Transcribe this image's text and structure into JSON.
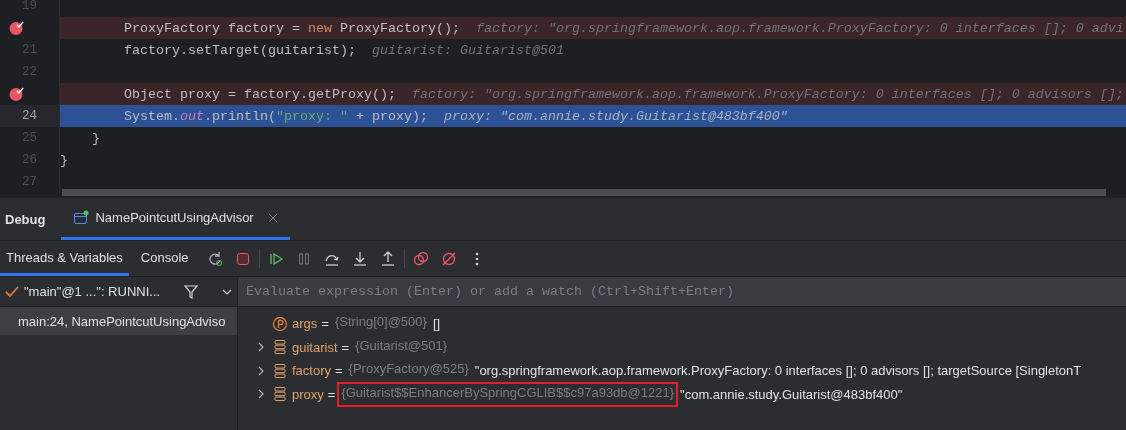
{
  "editor": {
    "lines": [
      {
        "number": "19",
        "breakpoint": false,
        "current": false
      },
      {
        "breakpoint": true,
        "current": false,
        "tokens": [
          {
            "kind": "plain",
            "text": "        ProxyFactory factory = "
          },
          {
            "kind": "keyword",
            "text": "new"
          },
          {
            "kind": "plain",
            "text": " ProxyFactory();"
          }
        ],
        "hint": "factory: \"org.springframework.aop.framework.ProxyFactory: 0 interfaces []; 0 advi"
      },
      {
        "number": "21",
        "breakpoint": false,
        "current": false,
        "tokens": [
          {
            "kind": "plain",
            "text": "        factory.setTarget(guitarist);"
          }
        ],
        "hint": "guitarist: Guitarist@501"
      },
      {
        "number": "22",
        "breakpoint": false,
        "current": false
      },
      {
        "breakpoint": true,
        "current": false,
        "tokens": [
          {
            "kind": "plain",
            "text": "        Object proxy = factory.getProxy();"
          }
        ],
        "hint": "factory: \"org.springframework.aop.framework.ProxyFactory: 0 interfaces []; 0 advisors [];"
      },
      {
        "number": "24",
        "breakpoint": false,
        "current": true,
        "tokens": [
          {
            "kind": "plain",
            "text": "        System."
          },
          {
            "kind": "static",
            "text": "out"
          },
          {
            "kind": "plain",
            "text": ".println("
          },
          {
            "kind": "string",
            "text": "\"proxy: \""
          },
          {
            "kind": "plain",
            "text": " + proxy);"
          }
        ],
        "hint": "proxy: \"com.annie.study.Guitarist@483bf400\""
      },
      {
        "number": "25",
        "breakpoint": false,
        "current": false,
        "tokens": [
          {
            "kind": "plain",
            "text": "    }"
          }
        ]
      },
      {
        "number": "26",
        "breakpoint": false,
        "current": false,
        "tokens": [
          {
            "kind": "plain",
            "text": "}"
          }
        ]
      },
      {
        "number": "27",
        "breakpoint": false,
        "current": false
      }
    ]
  },
  "debug": {
    "title": "Debug",
    "session_tabs": [
      {
        "label": "NamePointcutUsingAdvisor",
        "selected": true
      }
    ],
    "view_tabs": [
      {
        "label": "Threads & Variables",
        "selected": true
      },
      {
        "label": "Console",
        "selected": false
      }
    ],
    "thread": "\"main\"@1 ...\": RUNNI...",
    "evaluate": {
      "placeholder": "Evaluate expression (Enter) or add a watch (Ctrl+Shift+Enter)"
    },
    "frames": [
      {
        "label": "main:24, NamePointcutUsingAdviso",
        "selected": true
      }
    ],
    "variables": [
      {
        "kind": "param",
        "expandable": false,
        "name": "args",
        "operator": "=",
        "type": "{String[0]@500}",
        "value": "[]",
        "boxed": false
      },
      {
        "kind": "field",
        "expandable": true,
        "name": "guitarist",
        "operator": "=",
        "type": "{Guitarist@501}",
        "boxed": false
      },
      {
        "kind": "field",
        "expandable": true,
        "name": "factory",
        "operator": "=",
        "type": "{ProxyFactory@525}",
        "value": "\"org.springframework.aop.framework.ProxyFactory: 0 interfaces []; 0 advisors []; targetSource [SingletonT",
        "boxed": false
      },
      {
        "kind": "field",
        "expandable": true,
        "name": "proxy",
        "operator": "=",
        "type": "{Guitarist$$EnhancerBySpringCGLIB$$c97a93db@1221}",
        "value": "\"com.annie.study.Guitarist@483bf400\"",
        "boxed": true
      }
    ]
  }
}
